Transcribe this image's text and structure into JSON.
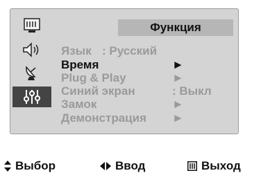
{
  "sidebar": {
    "items": [
      {
        "icon": "picture-icon",
        "active": false
      },
      {
        "icon": "sound-icon",
        "active": false
      },
      {
        "icon": "channel-antenna-icon",
        "active": false
      },
      {
        "icon": "function-settings-icon",
        "active": true
      }
    ]
  },
  "menu": {
    "title": "Функция",
    "items": [
      {
        "label": "Язык",
        "value": ": Русский",
        "selected": false
      },
      {
        "label": "Время",
        "value": "►",
        "selected": true
      },
      {
        "label": "Plug & Play",
        "value": "►",
        "selected": false
      },
      {
        "label": "Синий экран",
        "value": ": Выкл",
        "selected": false
      },
      {
        "label": "Замок",
        "value": "►",
        "selected": false
      },
      {
        "label": "Демонстрация",
        "value": "►",
        "selected": false
      }
    ]
  },
  "help": {
    "select_label": "Выбор",
    "enter_label": "Ввод",
    "exit_label": "Выход"
  },
  "colors": {
    "panel": "#d4d4d4",
    "header": "#b6b6b6",
    "active_sidebar": "#444444",
    "selected_text": "#111111",
    "inactive_text": "#9a9a9a"
  }
}
